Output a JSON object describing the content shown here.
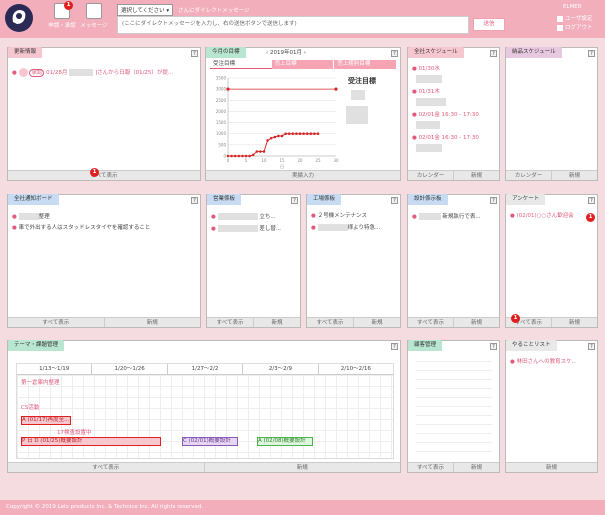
{
  "header": {
    "nav_apply": "申請・承認",
    "nav_message": "メッセージ",
    "apply_badge": "1",
    "dm_select": "選択してください ▾",
    "dm_label": "さんにダイレクトメッセージ",
    "dm_placeholder": "(ここにダイレクトメッセージを入力し、右の送信ボタンで送信します)",
    "send": "送信",
    "user_name": "ELMER",
    "user_settings": "ユーザ設定",
    "logout": "ログアウト"
  },
  "update": {
    "title": "更新情報",
    "entry_date": "01/28月",
    "entry_rest": "]さんから日報（01/25）が提...",
    "entry_tag": "承認",
    "footer": "すべて表示",
    "badge": "1"
  },
  "goal": {
    "title": "今月の目標",
    "month": "2019年01月",
    "tabs": [
      "受注目標",
      "売上目標",
      "売上粗利目標"
    ],
    "side_title": "受注目標",
    "y_ticks": [
      "3500",
      "3000",
      "2500",
      "2000",
      "1500",
      "1000",
      "500",
      "0"
    ],
    "x_ticks": [
      "0",
      "5",
      "10",
      "15",
      "20",
      "25",
      "30"
    ],
    "x_label": "日",
    "footer": "実績入力"
  },
  "company_schedule": {
    "title": "全社スケジュール",
    "items": [
      "01/30水",
      "01/31木",
      "02/01金 16:30 - 17:30",
      "02/01金 16:30 - 17:30"
    ],
    "footer1": "カレンダー",
    "footer2": "新規"
  },
  "sales_schedule": {
    "title": "納品スケジュール",
    "footer1": "カレンダー",
    "footer2": "新規"
  },
  "notice": {
    "title": "全社通知ボード",
    "items": [
      "整理",
      "車で外出する人はスタッドレスタイヤを確認すること"
    ],
    "footer1": "すべて表示",
    "footer2": "新規"
  },
  "sales_board": {
    "title": "営業係板",
    "items": [
      "立ち...",
      "差し替..."
    ],
    "footer1": "すべて表示",
    "footer2": "新規"
  },
  "factory_board": {
    "title": "工場係板",
    "items": [
      "２号機メンテナンス",
      "様より特急..."
    ],
    "footer1": "すべて表示",
    "footer2": "新規"
  },
  "design_board": {
    "title": "設計係示板",
    "items": [
      "新規執行で表..."
    ],
    "footer1": "すべて表示",
    "footer2": "新規"
  },
  "survey": {
    "title": "アンケート",
    "items": [
      "(02/01)○○さん歓迎会"
    ],
    "badge": "1",
    "footer1": "すべて表示",
    "footer2": "新規",
    "footer_badge": "1"
  },
  "gantt": {
    "title": "テーマ・課題管理",
    "weeks": [
      "1/13～1/19",
      "1/20～1/26",
      "1/27～2/2",
      "2/3～2/9",
      "2/10～2/16"
    ],
    "rows": [
      "第一倉庫内整理",
      "CS活動",
      "A (01/17)再度至...",
      "17検査設置中",
      "P 日 D (01/25)概要設計",
      "C (02/01)概要設計",
      "A (02/08)概要設計"
    ],
    "footer1": "すべて表示",
    "footer2": "新規"
  },
  "customer": {
    "title": "顧客管理",
    "footer1": "すべて表示",
    "footer2": "新規"
  },
  "todo": {
    "title": "やることリスト",
    "items": [
      "林田さんへの教育スケ..."
    ],
    "footer": "新規"
  },
  "footer": {
    "copyright": "Copyright © 2019 Lelo products Inc. & Technice Inc. All rights reserved."
  },
  "chart_data": {
    "type": "line",
    "x": [
      0,
      1,
      2,
      3,
      4,
      5,
      6,
      7,
      8,
      9,
      10,
      11,
      12,
      13,
      14,
      15,
      16,
      17,
      18,
      19,
      20,
      21,
      22,
      23,
      24,
      25,
      26,
      27,
      28,
      29,
      30
    ],
    "series": [
      {
        "name": "目標",
        "values": [
          3000,
          3000,
          3000,
          3000,
          3000,
          3000,
          3000,
          3000,
          3000,
          3000,
          3000,
          3000,
          3000,
          3000,
          3000,
          3000,
          3000,
          3000,
          3000,
          3000,
          3000,
          3000,
          3000,
          3000,
          3000,
          3000,
          3000,
          3000,
          3000,
          3000,
          3000
        ]
      },
      {
        "name": "実績",
        "values": [
          0,
          0,
          0,
          0,
          0,
          0,
          0,
          50,
          200,
          200,
          200,
          700,
          800,
          850,
          900,
          900,
          1000,
          1000,
          1000,
          1000,
          1000,
          1000,
          1000,
          1000,
          1000,
          1000,
          null,
          null,
          null,
          null,
          null
        ]
      }
    ],
    "xlabel": "日",
    "ylim": [
      0,
      3500
    ],
    "xlim": [
      0,
      30
    ]
  }
}
